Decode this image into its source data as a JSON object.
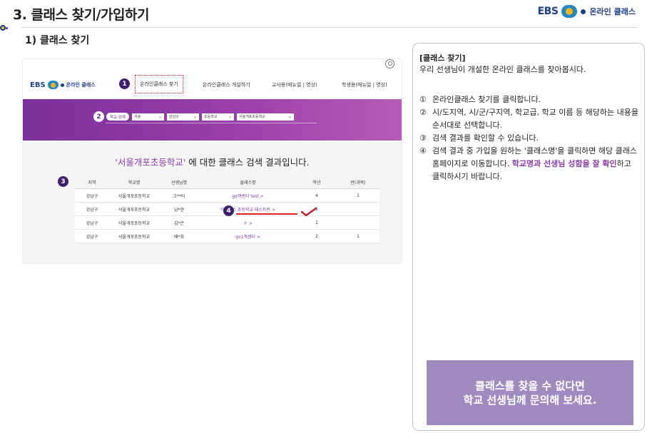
{
  "header": {
    "title": "3. 클래스 찾기/가입하기",
    "subtitle": "1) 클래스 찾기",
    "brand": {
      "ebs": "EBS",
      "name": "온라인 클래스"
    }
  },
  "screenshot": {
    "nav": {
      "brand_ebs": "EBS",
      "brand_name": "온라인 클래스",
      "items": [
        "온라인클래스 찾기",
        "온라인클래스 개설하기",
        "교사용(매뉴얼 | 영상)",
        "학생용(매뉴얼 | 영상)"
      ]
    },
    "badges": [
      "1",
      "2",
      "3",
      "4"
    ],
    "search": {
      "button": "학교 검색",
      "selects": [
        "서울",
        "강남구",
        "초등학교",
        "서울개포초등학교"
      ],
      "arrow": "⌄"
    },
    "result": {
      "query": "'서울개포초등학교'",
      "suffix": " 에 대한 클래스 검색 결과입니다."
    },
    "table": {
      "headers": [
        "지역",
        "학교명",
        "선생님명",
        "클래스명",
        "학년",
        "반(과목)"
      ],
      "rows": [
        [
          "강남구",
          "서울개포초등학교",
          "고**터",
          "go객센터 test >",
          "4",
          "1"
        ],
        [
          "강남구",
          "서울개포초등학교",
          "남*현",
          "이비에스 초등학교 테스트반 >",
          "1",
          ""
        ],
        [
          "강남구",
          "서울개포초등학교",
          "김*은",
          "ㅎ >",
          "1",
          ""
        ],
        [
          "강남구",
          "서울개포초등학교",
          "배*희",
          "go1객센터 >",
          "2",
          "1"
        ]
      ]
    }
  },
  "panel": {
    "heading": "[클래스 찾기]",
    "intro": "우리 선생님이 개설한 온라인 클래스를 찾아봅시다.",
    "steps": [
      {
        "n": "①",
        "text": "온라인클래스 찾기를 클릭합니다."
      },
      {
        "n": "②",
        "text": "시/도지역, 시/군/구지역, 학교급, 학교 이름 등 해당하는 내용을 순서대로 선택합니다."
      },
      {
        "n": "③",
        "text": "검색 결과를 확인할 수 있습니다."
      },
      {
        "n": "④",
        "text_pre": "검색 결과 중 가입을 원하는 '클래스명'을 클릭하면 해당 클래스 홈페이지로 이동합니다. ",
        "highlight": "학교명과 선생님 성함을 잘 확인",
        "text_post": "하고 클릭하시기 바랍니다."
      }
    ],
    "cta_line1": "클래스를 찾을 수 없다면",
    "cta_line2": "학교 선생님께 문의해 보세요."
  },
  "colors": {
    "accent": "#8a3da8",
    "badge": "#3f1e6b",
    "brand": "#1e3f8c",
    "cta": "#9f8bbf",
    "marker": "#d22222"
  }
}
